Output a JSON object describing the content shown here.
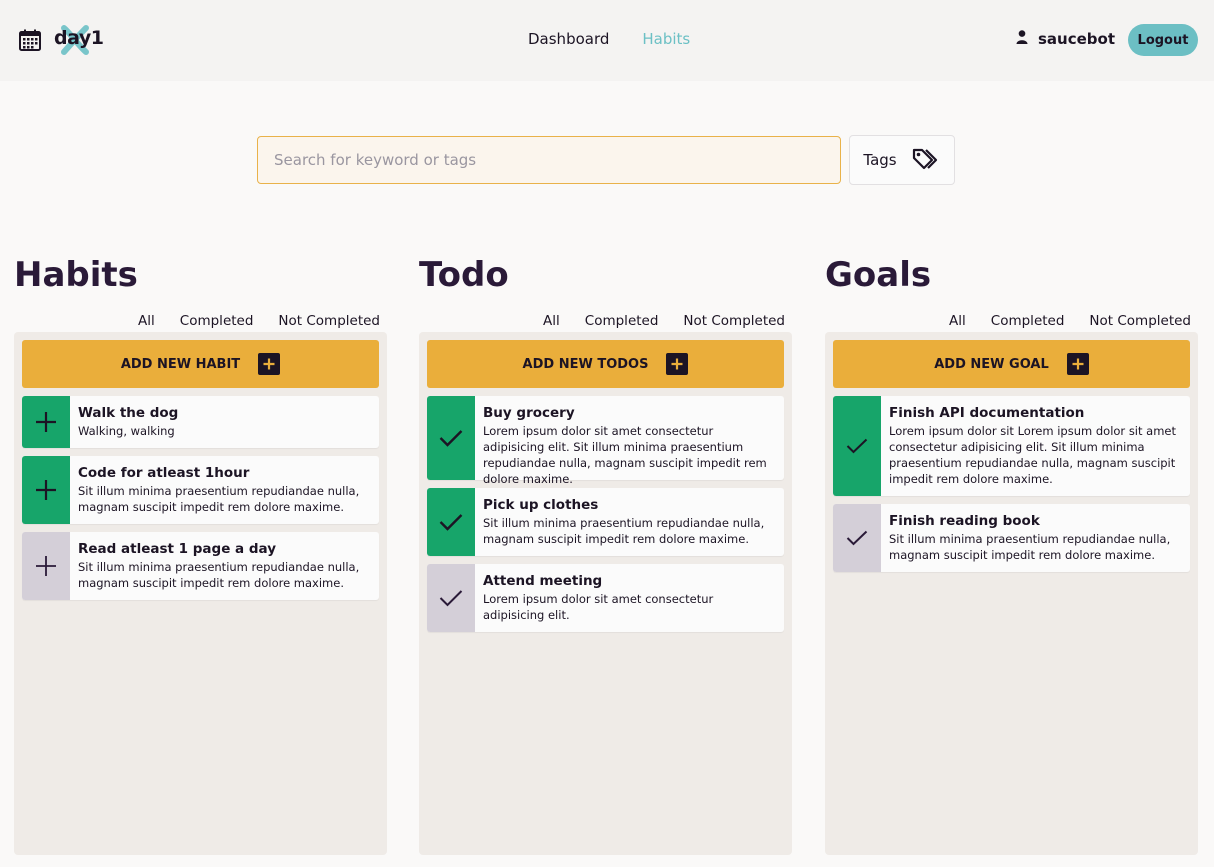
{
  "header": {
    "app_name": "day1",
    "nav": [
      {
        "label": "Dashboard",
        "active": false
      },
      {
        "label": "Habits",
        "active": true
      }
    ],
    "username": "saucebot",
    "logout_label": "Logout"
  },
  "search": {
    "placeholder": "Search for keyword or tags",
    "value": "",
    "tags_label": "Tags"
  },
  "colors": {
    "accent_teal": "#6cbfc4",
    "add_button": "#eaae3b",
    "done_green": "#17a56a",
    "pending_grey": "#d4cfd8"
  },
  "columns": [
    {
      "title": "Habits",
      "filters": [
        "All",
        "Completed",
        "Not Completed"
      ],
      "add_label": "ADD NEW HABIT",
      "items": [
        {
          "title": "Walk the dog",
          "desc": "Walking, walking",
          "status": "green",
          "icon": "plus-icon"
        },
        {
          "title": "Code for atleast 1hour",
          "desc": "Sit illum minima praesentium repudiandae nulla, magnam suscipit impedit rem dolore maxime.",
          "status": "green",
          "icon": "plus-icon"
        },
        {
          "title": "Read atleast 1 page a day",
          "desc": "Sit illum minima praesentium repudiandae nulla, magnam suscipit impedit rem dolore maxime.",
          "status": "grey",
          "icon": "plus-icon"
        }
      ]
    },
    {
      "title": "Todo",
      "filters": [
        "All",
        "Completed",
        "Not Completed"
      ],
      "add_label": "ADD NEW TODOS",
      "items": [
        {
          "title": "Buy grocery",
          "desc": "Lorem ipsum dolor sit amet consectetur adipisicing elit. Sit illum minima praesentium repudiandae nulla, magnam suscipit impedit rem dolore maxime.",
          "status": "green",
          "icon": "check-icon"
        },
        {
          "title": "Pick up clothes",
          "desc": "Sit illum minima praesentium repudiandae nulla, magnam suscipit impedit rem dolore maxime.",
          "status": "green",
          "icon": "check-icon"
        },
        {
          "title": "Attend meeting",
          "desc": "Lorem ipsum dolor sit amet consectetur adipisicing elit.",
          "status": "grey",
          "icon": "check-icon"
        }
      ]
    },
    {
      "title": "Goals",
      "filters": [
        "All",
        "Completed",
        "Not Completed"
      ],
      "add_label": "ADD NEW GOAL",
      "items": [
        {
          "title": "Finish API documentation",
          "desc": "Lorem ipsum dolor sit Lorem ipsum dolor sit amet consectetur adipisicing elit. Sit illum minima praesentium repudiandae nulla, magnam suscipit impedit rem dolore maxime.",
          "status": "green",
          "icon": "check-icon"
        },
        {
          "title": "Finish reading book",
          "desc": "Sit illum minima praesentium repudiandae nulla, magnam suscipit impedit rem dolore maxime.",
          "status": "grey",
          "icon": "check-icon"
        }
      ]
    }
  ]
}
